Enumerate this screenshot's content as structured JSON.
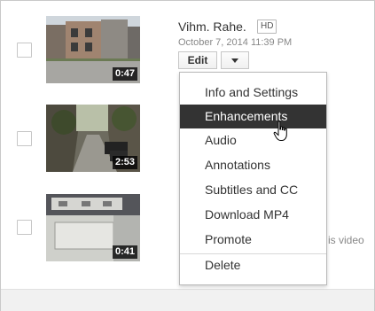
{
  "videos": [
    {
      "duration": "0:47",
      "title": "Vihm. Rahe.",
      "badge": "HD",
      "date": "October 7, 2014 11:39 PM"
    },
    {
      "duration": "2:53"
    },
    {
      "duration": "0:41"
    }
  ],
  "edit_button": {
    "label": "Edit",
    "arrow_icon": "caret-down-icon"
  },
  "behind_menu_text": "is video",
  "menu": {
    "items": [
      {
        "label": "Info and Settings"
      },
      {
        "label": "Enhancements",
        "active": true
      },
      {
        "label": "Audio"
      },
      {
        "label": "Annotations"
      },
      {
        "label": "Subtitles and CC"
      },
      {
        "label": "Download MP4"
      },
      {
        "label": "Promote"
      },
      {
        "label": "Delete"
      }
    ]
  },
  "colors": {
    "active_item_bg": "#333333",
    "active_item_text": "#ffffff",
    "duration_bg": "#000000"
  }
}
